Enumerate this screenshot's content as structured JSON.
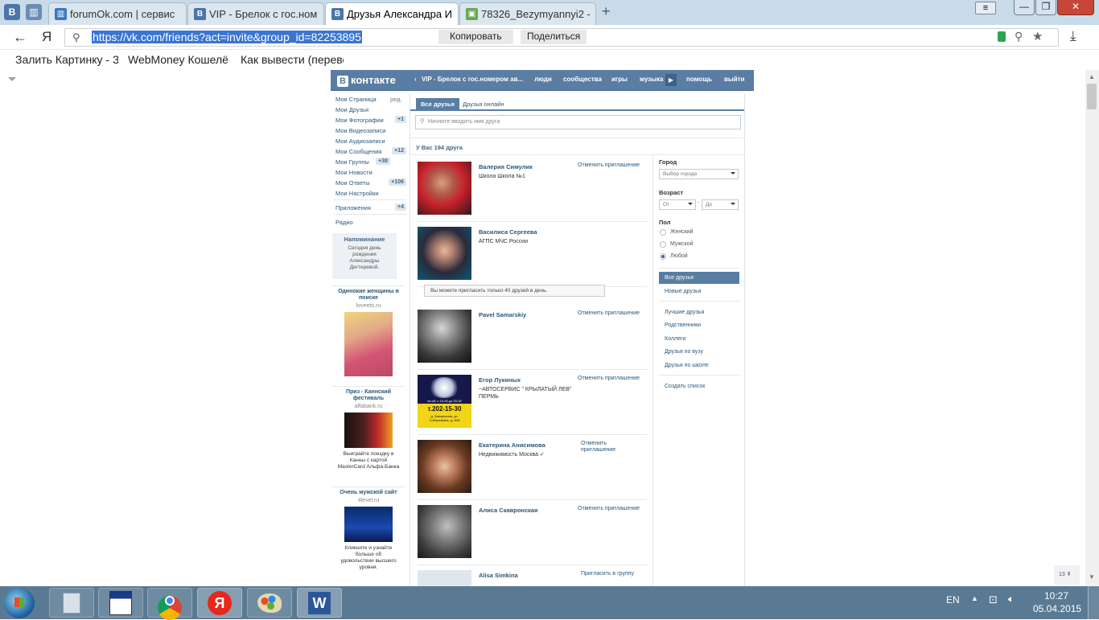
{
  "browser": {
    "tabs": [
      {
        "label": "forumOk.com | сервис"
      },
      {
        "label": "VIP - Брелок с гос.ном"
      },
      {
        "label": "Друзья Александра И"
      },
      {
        "label": "78326_Bezymyannyi2 -"
      }
    ],
    "url": "https://vk.com/friends?act=invite&group_id=82253895",
    "copy_label": "Копировать",
    "share_label": "Поделиться",
    "bookmarks": [
      "Залить Картинку - З",
      "WebMoney Кошелё",
      "Как вывести (переве"
    ]
  },
  "vk": {
    "logo_text": "контакте",
    "header_links": [
      "VIP - Брелок с гос.номером ав...",
      "люди",
      "сообщества",
      "игры",
      "музыка",
      "помощь",
      "выйти"
    ],
    "sidebar": {
      "items": [
        {
          "label": "Моя Страница",
          "extra": "ред."
        },
        {
          "label": "Мои Друзья",
          "extra": ""
        },
        {
          "label": "Мои Фотографии",
          "extra": "+1"
        },
        {
          "label": "Мои Видеозаписи",
          "extra": ""
        },
        {
          "label": "Мои Аудиозаписи",
          "extra": ""
        },
        {
          "label": "Мои Сообщения",
          "extra": "+12"
        },
        {
          "label": "Мои Группы",
          "extra": "+38"
        },
        {
          "label": "Мои Новости",
          "extra": ""
        },
        {
          "label": "Мои Ответы",
          "extra": "+106"
        },
        {
          "label": "Мои Настройки",
          "extra": ""
        }
      ],
      "apps": {
        "label": "Приложения",
        "extra": "+4"
      },
      "radio": "Радио",
      "reminder_title": "Напоминание",
      "reminder_text": "Сегодня день рождения Александры Дегтеревой.",
      "ads": [
        {
          "title": "Одинокие женщины в поиске",
          "domain": "loveeto.ru",
          "text": ""
        },
        {
          "title": "Приз - Каннский фестиваль",
          "domain": "alfabank.ru",
          "text": "Выиграйте поездку в Канны с картой MasterCard Альфа-Банка"
        },
        {
          "title": "Очень мужской сайт",
          "domain": "4level.ru",
          "text": "Кликните и узнайте больше об удовольствии высшего уровня."
        }
      ]
    },
    "tabs": {
      "all_friends": "Все друзья",
      "online": "Друзья онлайн"
    },
    "search_placeholder": "Начните вводить имя друга",
    "friends_count": "У Вас 194 друга",
    "limit_notice": "Вы можете пригласить только 40 друзей в день.",
    "friends": [
      {
        "name": "Валерия Симулик",
        "info": "Школа Школа №1",
        "action": "Отменить приглашение"
      },
      {
        "name": "Василиса Сергеева",
        "info": "АГПС МЧС России",
        "action": ""
      },
      {
        "name": "Pavel Samarskiy",
        "info": "",
        "action": "Отменить приглашение"
      },
      {
        "name": "Егор Лукиных",
        "info": "~АВТОСЕРВИС \" КРЫЛАТЫЙ ЛЕВ\" ПЕРМЬ",
        "action": "Отменить приглашение"
      },
      {
        "name": "Екатерина Анисимова",
        "info": "Недвижимость Москва ✓",
        "action": "Отменить приглашение"
      },
      {
        "name": "Алиса Скавронская",
        "info": "",
        "action": "Отменить приглашение"
      },
      {
        "name": "Alisa Simkina",
        "info": "",
        "action": "Пригласить в группу"
      }
    ],
    "photo_texts": {
      "ad_phone": "т.202-15-30",
      "ad_address": "д. Заворохина, ул. Соболевских, д. 80А",
      "ad_hours": "пн-сб: с 10-00 до 20-00"
    },
    "filters": {
      "city_label": "Город",
      "city_placeholder": "Выбор города",
      "age_label": "Возраст",
      "age_from": "От",
      "age_dash": "-",
      "age_to": "До",
      "sex_label": "Пол",
      "sex_options": [
        "Женский",
        "Мужской",
        "Любой"
      ],
      "lists": [
        "Все друзья",
        "Новые друзья",
        "Лучшие друзья",
        "Родственники",
        "Коллеги",
        "Друзья по вузу",
        "Друзья по школе",
        "Создать список"
      ]
    },
    "scroll_badge": "13"
  },
  "taskbar": {
    "lang": "EN",
    "time": "10:27",
    "date": "05.04.2015"
  }
}
